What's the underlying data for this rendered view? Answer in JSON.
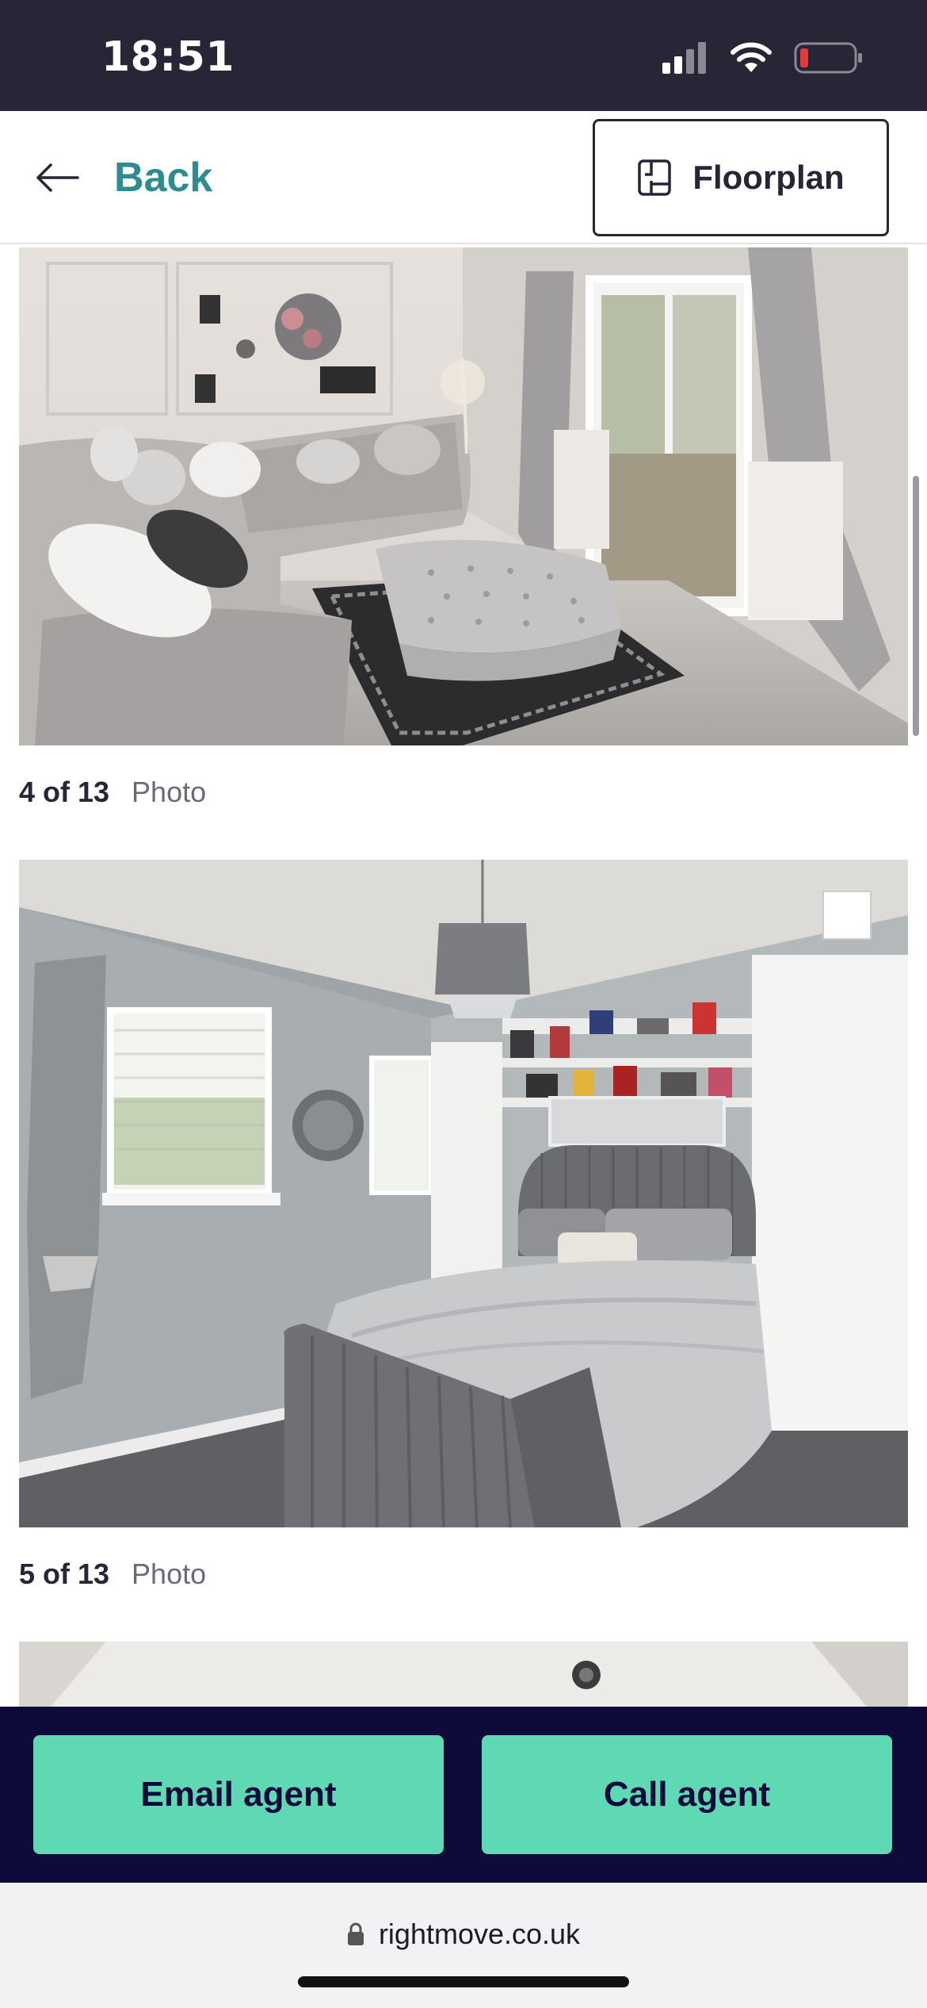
{
  "status_bar": {
    "time": "18:51",
    "icons": [
      "signal-icon",
      "wifi-icon",
      "battery-icon"
    ]
  },
  "header": {
    "back_label": "Back",
    "floorplan_label": "Floorplan"
  },
  "gallery": {
    "photos": [
      {
        "count": "4 of 13",
        "type": "Photo",
        "alt": "Living room with grey corner sofa and tufted ottoman"
      },
      {
        "count": "5 of 13",
        "type": "Photo",
        "alt": "Bedroom with grey upholstered bed and white wardrobes"
      },
      {
        "count": "",
        "type": "",
        "alt": "Next photo (partially visible)"
      }
    ]
  },
  "actions": {
    "email_label": "Email agent",
    "call_label": "Call agent"
  },
  "browser": {
    "url": "rightmove.co.uk"
  },
  "colors": {
    "status_bar_bg": "#262637",
    "back_text": "#2e8b8f",
    "action_bar_bg": "#0e0b3c",
    "action_button": "#5fd9b3"
  }
}
